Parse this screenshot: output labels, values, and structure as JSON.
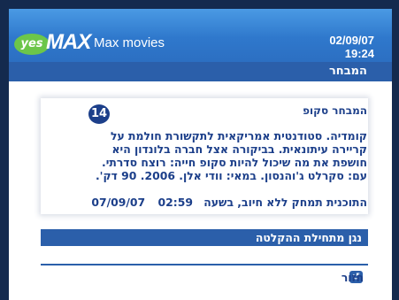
{
  "app": {
    "logo_yes": "yes",
    "logo_max": "MAX",
    "title": "Max movies",
    "date": "02/09/07",
    "time": "19:24"
  },
  "section": {
    "title": "המבחר"
  },
  "program": {
    "title": "המבחר סקופ",
    "rating": "14",
    "description_lines": [
      "קומדיה. סטודנטית אמריקאית לתקשורת חולמת על",
      "קריירה עיתונאית. בביקורה אצל חברה בלונדון היא",
      "חושפת את מה שיכול להיות סקופ חייה: רוצח סדרתי.",
      "עם: סקרלט ג'והנסון. במאי: וודי אלן. 2006. 90 דק'."
    ],
    "schedule_text": "התוכנית תמחק ללא חיוב, בשעה",
    "schedule_time": "02:59",
    "schedule_date": "07/09/07"
  },
  "actions": {
    "record_label": "נגן מתחילת ההקלטה",
    "back_label": "חזור",
    "back_icon": "↺"
  },
  "colors": {
    "header_blue": "#2f78cc",
    "bar_blue": "#2b5faa",
    "text_navy": "#1c3f8a",
    "logo_green": "#6cc64a"
  }
}
